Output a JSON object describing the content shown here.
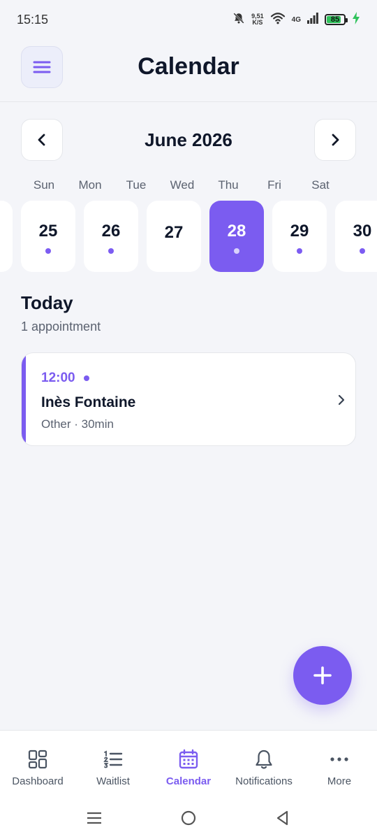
{
  "status_bar": {
    "time": "15:15",
    "net_speed_value": "9,51",
    "net_speed_unit": "K/S",
    "network_type": "4G",
    "battery_level": "85",
    "icons": [
      "bell-off-icon",
      "wifi-icon",
      "signal-icon",
      "battery-icon",
      "charging-icon"
    ]
  },
  "header": {
    "title": "Calendar",
    "menu_icon": "hamburger-menu-icon"
  },
  "month_nav": {
    "label": "June 2026",
    "prev_icon": "chevron-left-icon",
    "next_icon": "chevron-right-icon"
  },
  "weekdays": [
    "Sun",
    "Mon",
    "Tue",
    "Wed",
    "Thu",
    "Fri",
    "Sat"
  ],
  "days": [
    {
      "num": "25",
      "has_dot": true,
      "selected": false
    },
    {
      "num": "26",
      "has_dot": true,
      "selected": false
    },
    {
      "num": "27",
      "has_dot": false,
      "selected": false
    },
    {
      "num": "28",
      "has_dot": true,
      "selected": true
    },
    {
      "num": "29",
      "has_dot": true,
      "selected": false
    },
    {
      "num": "30",
      "has_dot": true,
      "selected": false
    }
  ],
  "today": {
    "title": "Today",
    "subtitle": "1 appointment"
  },
  "appointments": [
    {
      "time": "12:00",
      "name": "Inès Fontaine",
      "meta": "Other · 30min"
    }
  ],
  "fab": {
    "icon": "plus-icon"
  },
  "bottom_nav": [
    {
      "label": "Dashboard",
      "icon": "dashboard-grid-icon",
      "active": false
    },
    {
      "label": "Waitlist",
      "icon": "numbered-list-icon",
      "active": false
    },
    {
      "label": "Calendar",
      "icon": "calendar-icon",
      "active": true
    },
    {
      "label": "Notifications",
      "icon": "bell-icon",
      "active": false
    },
    {
      "label": "More",
      "icon": "more-dots-icon",
      "active": false
    }
  ],
  "colors": {
    "accent": "#7b5cf0",
    "background": "#f4f5f9",
    "text_primary": "#0f172a",
    "text_secondary": "#5b6270"
  }
}
